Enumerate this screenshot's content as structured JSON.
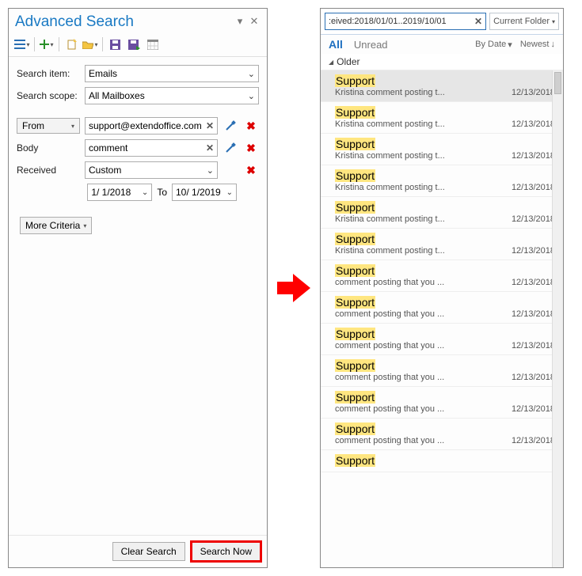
{
  "left": {
    "title": "Advanced Search",
    "form": {
      "search_item_label": "Search item:",
      "search_item_value": "Emails",
      "search_scope_label": "Search scope:",
      "search_scope_value": "All Mailboxes",
      "from_label": "From",
      "from_value": "support@extendoffice.com",
      "body_label": "Body",
      "body_value": "comment",
      "received_label": "Received",
      "received_value": "Custom",
      "date_from": "1/  1/2018",
      "date_to_label": "To",
      "date_to": "10/  1/2019",
      "more_criteria": "More Criteria"
    },
    "buttons": {
      "clear": "Clear Search",
      "search_now": "Search Now"
    }
  },
  "right": {
    "search_query": ":eived:2018/01/01..2019/10/01",
    "scope_label": "Current Folder",
    "tabs": {
      "all": "All",
      "unread": "Unread"
    },
    "sort": {
      "by": "By Date",
      "order": "Newest"
    },
    "group_header": "Older",
    "items": [
      {
        "from": "Support",
        "subject": "Kristina comment posting t...",
        "date": "12/13/2018",
        "selected": true
      },
      {
        "from": "Support",
        "subject": "Kristina comment posting t...",
        "date": "12/13/2018"
      },
      {
        "from": "Support",
        "subject": "Kristina comment posting t...",
        "date": "12/13/2018"
      },
      {
        "from": "Support",
        "subject": "Kristina comment posting t...",
        "date": "12/13/2018"
      },
      {
        "from": "Support",
        "subject": "Kristina comment posting t...",
        "date": "12/13/2018"
      },
      {
        "from": "Support",
        "subject": "Kristina comment posting t...",
        "date": "12/13/2018"
      },
      {
        "from": "Support",
        "subject": "comment posting that you ...",
        "date": "12/13/2018"
      },
      {
        "from": "Support",
        "subject": "comment posting that you ...",
        "date": "12/13/2018"
      },
      {
        "from": "Support",
        "subject": "comment posting that you ...",
        "date": "12/13/2018"
      },
      {
        "from": "Support",
        "subject": "comment posting that you ...",
        "date": "12/13/2018"
      },
      {
        "from": "Support",
        "subject": "comment posting that you ...",
        "date": "12/13/2018"
      },
      {
        "from": "Support",
        "subject": "comment posting that you ...",
        "date": "12/13/2018"
      },
      {
        "from": "Support",
        "subject": "",
        "date": ""
      }
    ]
  }
}
